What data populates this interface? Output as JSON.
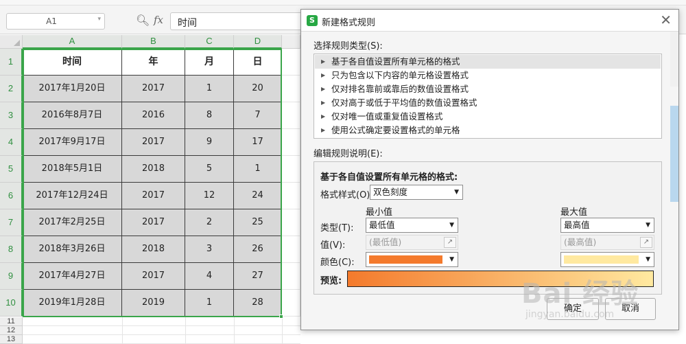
{
  "formula_bar": {
    "cell_ref": "A1",
    "cell_ref_arrow": "▾",
    "zoom_icon": "zoom-icon",
    "fx_label": "fx",
    "formula_value": "时间"
  },
  "sheet": {
    "columns": [
      "A",
      "B",
      "C",
      "D"
    ],
    "rows": [
      "1",
      "2",
      "3",
      "4",
      "5",
      "6",
      "7",
      "8",
      "9",
      "10",
      "11",
      "12",
      "13"
    ],
    "header": [
      "时间",
      "年",
      "月",
      "日"
    ],
    "data": [
      [
        "2017年1月20日",
        "2017",
        "1",
        "20"
      ],
      [
        "2016年8月7日",
        "2016",
        "8",
        "7"
      ],
      [
        "2017年9月17日",
        "2017",
        "9",
        "17"
      ],
      [
        "2018年5月1日",
        "2018",
        "5",
        "1"
      ],
      [
        "2017年12月24日",
        "2017",
        "12",
        "24"
      ],
      [
        "2017年2月25日",
        "2017",
        "2",
        "25"
      ],
      [
        "2018年3月26日",
        "2018",
        "3",
        "26"
      ],
      [
        "2017年4月27日",
        "2017",
        "4",
        "27"
      ],
      [
        "2019年1月28日",
        "2019",
        "1",
        "28"
      ]
    ],
    "selection_color": "#3aa54a",
    "selected_fill": "#d8d8d8"
  },
  "dialog": {
    "app_icon_letter": "S",
    "title": "新建格式规则",
    "close_symbol": "✕",
    "select_type_label": "选择规则类型(S):",
    "rule_types": [
      "基于各自值设置所有单元格的格式",
      "只为包含以下内容的单元格设置格式",
      "仅对排名靠前或靠后的数值设置格式",
      "仅对高于或低于平均值的数值设置格式",
      "仅对唯一值或重复值设置格式",
      "使用公式确定要设置格式的单元格"
    ],
    "edit_desc_label": "编辑规则说明(E):",
    "desc_title": "基于各自值设置所有单元格的格式:",
    "format_style_label": "格式样式(O):",
    "format_style_value": "双色刻度",
    "min_header": "最小值",
    "max_header": "最大值",
    "type_label": "类型(T):",
    "min_type": "最低值",
    "max_type": "最高值",
    "value_label": "值(V):",
    "min_value_placeholder": "(最低值)",
    "max_value_placeholder": "(最高值)",
    "color_label": "颜色(C):",
    "min_color": "#f47a2c",
    "max_color": "#ffe9a0",
    "preview_label": "预览:",
    "ok_label": "确定",
    "cancel_label": "取消",
    "dropdown_arrow": "▼"
  },
  "watermark": {
    "big": "Bai 经验",
    "small": "jingyan.baidu.com"
  }
}
